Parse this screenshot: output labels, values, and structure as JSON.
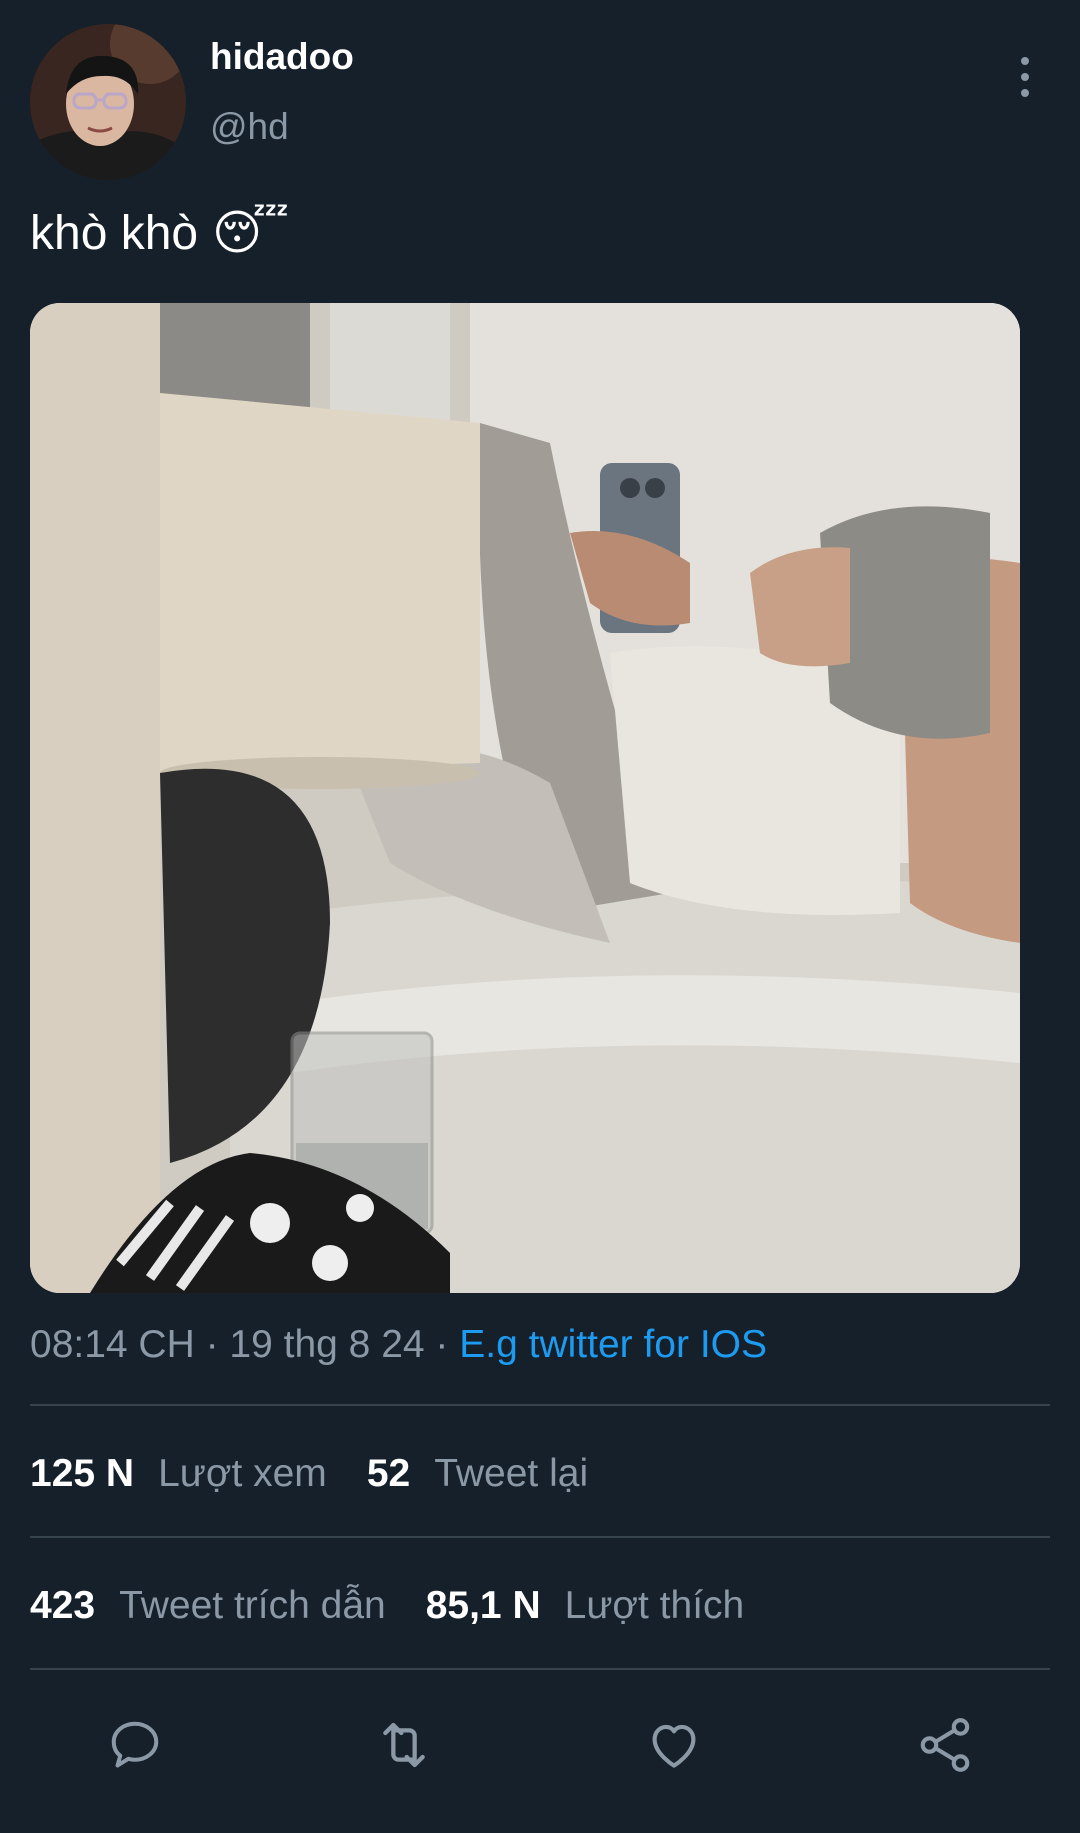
{
  "tweet": {
    "display_name": "hidadoo",
    "handle": "@hd",
    "text": "khò khò",
    "emoji": "😴",
    "timestamp": "08:14 CH · 19 thg 8 24 · ",
    "source": "E.g twitter for IOS"
  },
  "stats": {
    "views_count": "125 N",
    "views_label": "Lượt xem",
    "retweets_count": "52",
    "retweets_label": "Tweet lại",
    "quotes_count": "423",
    "quotes_label": "Tweet trích dẫn",
    "likes_count": "85,1 N",
    "likes_label": "Lượt thích"
  },
  "actions": [
    "reply-icon",
    "retweet-icon",
    "like-icon",
    "share-icon"
  ],
  "colors": {
    "background": "#15202b",
    "secondary_text": "#8b98a5",
    "accent": "#1d9bf0",
    "divider": "#38444d"
  }
}
